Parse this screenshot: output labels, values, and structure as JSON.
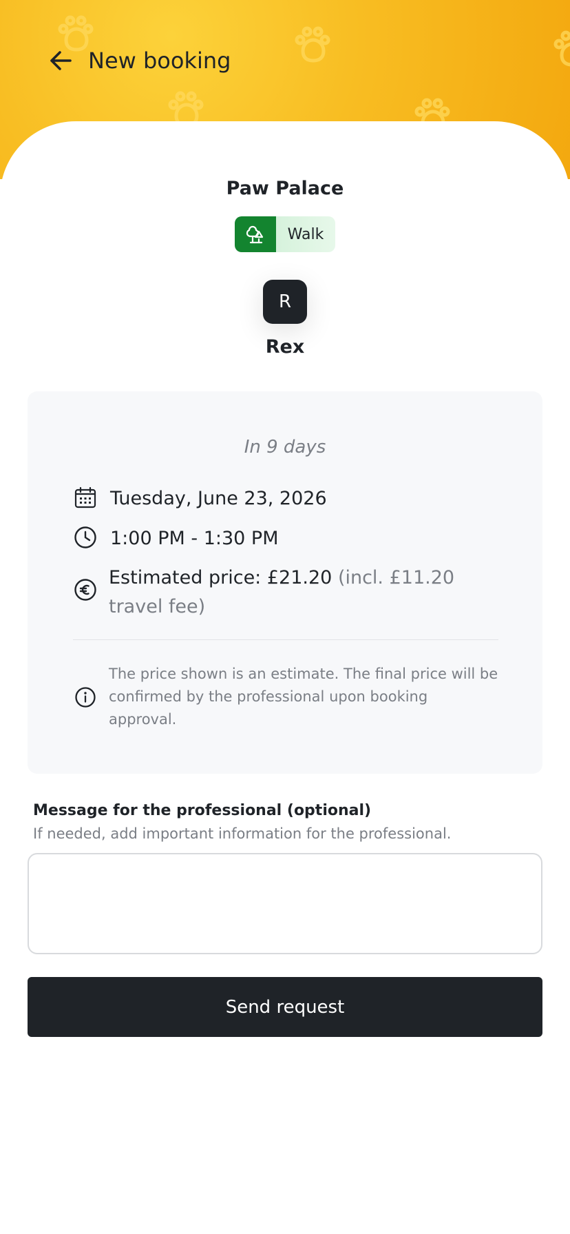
{
  "header": {
    "title": "New booking",
    "back_icon": "arrow-left-icon",
    "bg_colors": [
      "#fcd23a",
      "#f8bd22",
      "#f3a80f"
    ]
  },
  "provider": {
    "name": "Paw Palace"
  },
  "service": {
    "label": "Walk",
    "icon": "trees-icon",
    "icon_bg": "#13842f",
    "label_bg": "#e1f6e5"
  },
  "pet": {
    "initial": "R",
    "name": "Rex"
  },
  "booking": {
    "relative_date": "In 9 days",
    "date": "Tuesday, June 23, 2026",
    "time": "1:00 PM - 1:30 PM",
    "price_label": "Estimated price: £21.20",
    "price_note": "(incl. £11.20 travel fee)",
    "disclaimer": "The price shown is an estimate. The final price will be confirmed by the professional upon booking approval."
  },
  "message": {
    "label": "Message for the professional (optional)",
    "hint": "If needed, add important information for the professional.",
    "value": "",
    "placeholder": ""
  },
  "actions": {
    "send_label": "Send request"
  },
  "colors": {
    "primary_dark": "#1f2328",
    "muted_text": "#7a7e85",
    "card_bg": "#f7f8fa"
  }
}
